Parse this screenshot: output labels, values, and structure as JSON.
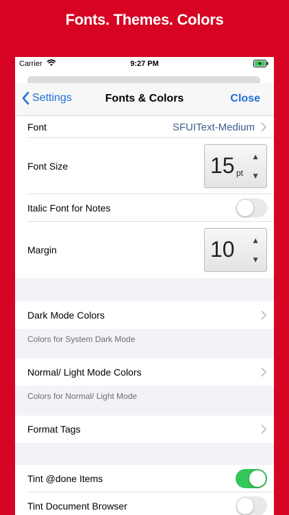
{
  "headline": "Fonts. Themes. Colors",
  "status_bar": {
    "carrier": "Carrier",
    "time": "9:27 PM",
    "wifi_icon": "wifi-icon",
    "battery_icon": "battery-charging-icon"
  },
  "nav": {
    "back_label": "Settings",
    "title": "Fonts & Colors",
    "close_label": "Close"
  },
  "settings": {
    "font_label": "Font",
    "font_value": "SFUIText-Medium",
    "font_size_label": "Font Size",
    "font_size_value": "15",
    "font_size_unit": "pt",
    "italic_label": "Italic Font for Notes",
    "italic_on": false,
    "margin_label": "Margin",
    "margin_value": "10",
    "dark_mode_label": "Dark Mode Colors",
    "dark_mode_note": "Colors for System Dark Mode",
    "light_mode_label": "Normal/ Light Mode Colors",
    "light_mode_note": "Colors for Normal/ Light Mode",
    "format_tags_label": "Format Tags",
    "tint_done_label": "Tint @done Items",
    "tint_done_on": true,
    "tint_browser_label": "Tint Document Browser",
    "tint_browser_on": false
  },
  "colors": {
    "brand_red": "#d70322",
    "ios_blue": "#1f6fd8",
    "toggle_green": "#34c759"
  }
}
